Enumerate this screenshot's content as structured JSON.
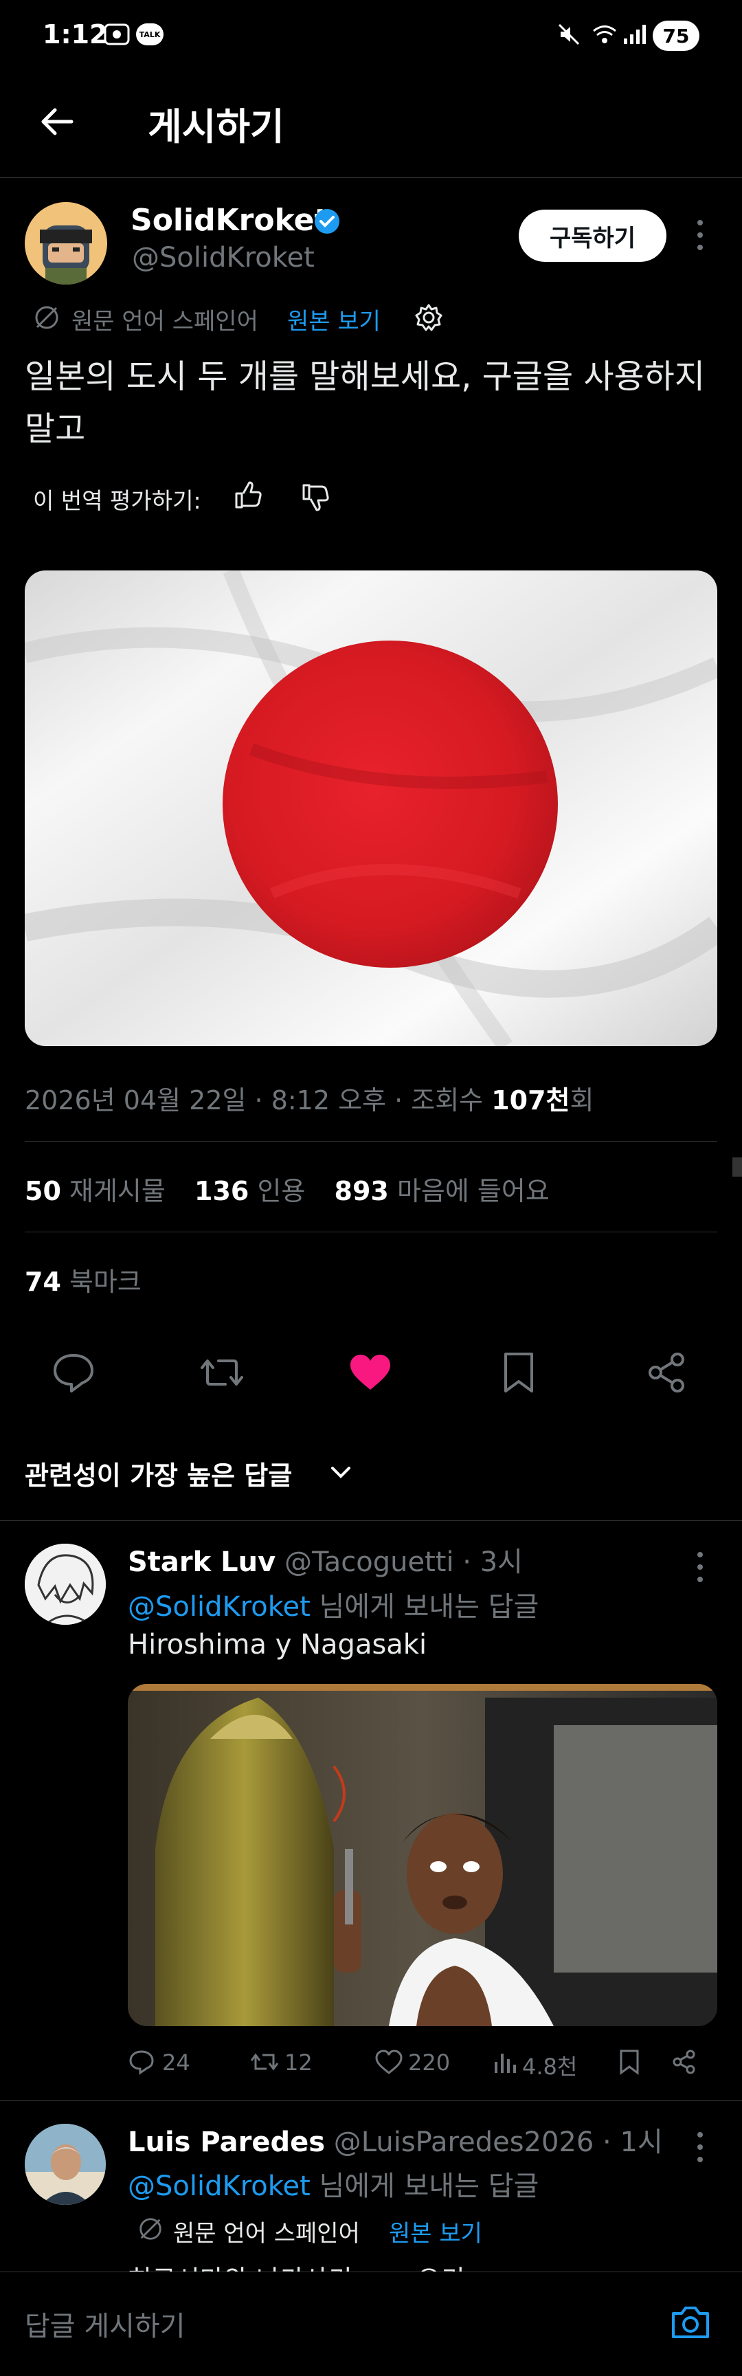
{
  "status_bar": {
    "time": "1:12",
    "battery": "75",
    "talk_label": "TALK"
  },
  "header": {
    "title": "게시하기"
  },
  "post": {
    "author_name": "SolidKroket",
    "author_handle": "@SolidKroket",
    "subscribe_label": "구독하기",
    "translated_from": "원문 언어 스페인어",
    "view_original": "원본 보기",
    "text": "일본의 도시 두 개를 말해보세요, 구글을 사용하지 말고",
    "rate_translation": "이 번역 평가하기:",
    "meta_date": "2026년 04월 22일 · 8:12 오후 · 조회수 ",
    "meta_views": "107천",
    "meta_views_suffix": "회",
    "reposts_num": "50",
    "reposts_label": "재게시물",
    "quotes_num": "136",
    "quotes_label": "인용",
    "likes_num": "893",
    "likes_label": "마음에 들어요",
    "bookmarks_num": "74",
    "bookmarks_label": "북마크",
    "like_color": "#f91880"
  },
  "replies_sort": {
    "label": "관련성이 가장 높은 답글"
  },
  "replies": [
    {
      "name": "Stark Luv",
      "handle": "@Tacoguetti",
      "time": " · 3시",
      "reply_to_handle": "@SolidKroket",
      "reply_to_suffix": " 님에게 보내는 답글",
      "text": "Hiroshima y Nagasaki",
      "comments": "24",
      "reposts": "12",
      "likes": "220",
      "views": "4.8천"
    },
    {
      "name": "Luis Paredes",
      "handle": "@LuisParedes2026",
      "time": " · 1시",
      "reply_to_handle": "@SolidKroket",
      "reply_to_suffix": " 님에게 보내는 답글",
      "translated_from": "원문 언어 스페인어",
      "view_original": "원본 보기",
      "text": "히로시마와 나가사키 ㅋㅋ 오키"
    }
  ],
  "composer": {
    "placeholder": "답글 게시하기"
  }
}
